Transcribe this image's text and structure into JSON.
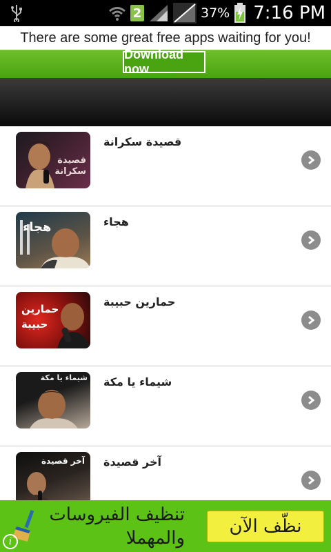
{
  "status_bar": {
    "notification_badge": "2",
    "battery_percent": "37%",
    "time": "7:16 PM"
  },
  "top_banner": {
    "text": "There are some great free apps waiting for you!",
    "button_label": "Download now"
  },
  "list": {
    "items": [
      {
        "title": "قصيدة سكرانة",
        "thumb_caption": "قصيدة سكرانة",
        "thumb_colors": [
          "#1d1b20",
          "#6a2e4a"
        ]
      },
      {
        "title": "هجاء",
        "thumb_caption": "هجاء",
        "thumb_colors": [
          "#1f3a4a",
          "#9a7a55"
        ]
      },
      {
        "title": "حمارين حبيبة",
        "thumb_caption": "حمارين حبيبة",
        "thumb_colors": [
          "#2a0a0a",
          "#c0211d"
        ]
      },
      {
        "title": "شيماء يا مكة",
        "thumb_caption": "شيماء يا مكة",
        "thumb_colors": [
          "#1a1a1a",
          "#b8a99a"
        ]
      },
      {
        "title": "آخر قصيدة",
        "thumb_caption": "آخر قصيدة",
        "thumb_colors": [
          "#0f0f0f",
          "#6b5b4f"
        ]
      }
    ]
  },
  "bottom_ad": {
    "text": "تنظيف الفيروسات والمهملا",
    "button_label": "نظّف الآن",
    "info_glyph": "i"
  },
  "colors": {
    "accent_green": "#4aa311",
    "ad_green": "#5cc216",
    "ad_button_yellow": "#f3ef3e"
  },
  "icons": [
    "usb-icon",
    "wifi-icon",
    "signal-icon",
    "battery-icon",
    "chevron-right-icon",
    "broom-icon",
    "info-icon"
  ]
}
